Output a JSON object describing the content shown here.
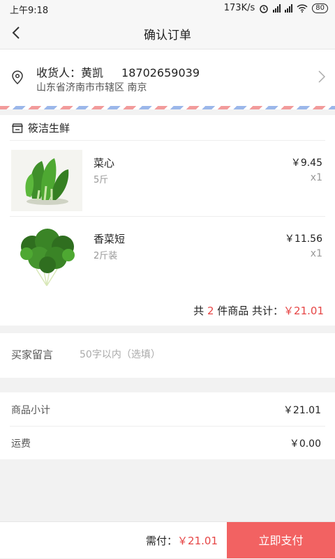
{
  "status_bar": {
    "time": "上午9:18",
    "speed": "173K/s",
    "battery": "80"
  },
  "header": {
    "title": "确认订单"
  },
  "address": {
    "receiver_label": "收货人：",
    "receiver_name": "黄凯",
    "phone": "18702659039",
    "detail": "山东省济南市市辖区 南京"
  },
  "store": {
    "name": "筱洁生鲜",
    "items": [
      {
        "name": "菜心",
        "spec": "5斤",
        "price": "￥9.45",
        "qty": "x1"
      },
      {
        "name": "香菜短",
        "spec": "2斤装",
        "price": "￥11.56",
        "qty": "x1"
      }
    ],
    "total": {
      "prefix": "共",
      "count": "2",
      "middle": "件商品 共计：",
      "amount": "￥21.01"
    }
  },
  "note": {
    "label": "买家留言",
    "placeholder": "50字以内（选填）",
    "value": ""
  },
  "summary": {
    "subtotal_label": "商品小计",
    "subtotal_value": "￥21.01",
    "shipping_label": "运费",
    "shipping_value": "￥0.00"
  },
  "footer": {
    "due_label": "需付：",
    "due_amount": "￥21.01",
    "pay_button": "立即支付"
  },
  "colors": {
    "accent": "#e64545",
    "pay_button_bg": "#f26262"
  }
}
